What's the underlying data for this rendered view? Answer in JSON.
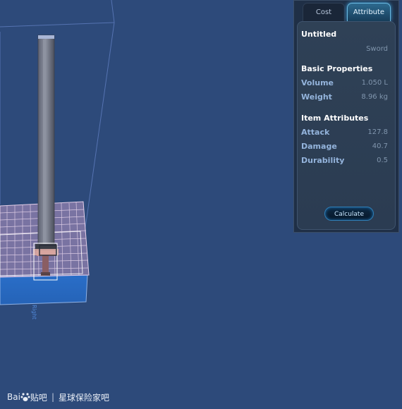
{
  "viewport": {
    "axis_label": "Right"
  },
  "panel": {
    "tabs": [
      {
        "label": "Cost",
        "active": false
      },
      {
        "label": "Attribute",
        "active": true
      }
    ],
    "item_name": "Untitled",
    "item_type": "Sword",
    "basic_properties": {
      "heading": "Basic Properties",
      "rows": [
        {
          "label": "Volume",
          "value": "1.050 L"
        },
        {
          "label": "Weight",
          "value": "8.96 kg"
        }
      ]
    },
    "item_attributes": {
      "heading": "Item Attributes",
      "rows": [
        {
          "label": "Attack",
          "value": "127.8"
        },
        {
          "label": "Damage",
          "value": "40.7"
        },
        {
          "label": "Durability",
          "value": "0.5"
        }
      ]
    },
    "calculate_label": "Calculate"
  },
  "watermark": {
    "logo_text": "Bai",
    "logo_suffix": "贴吧",
    "site": "星球保险家吧"
  }
}
